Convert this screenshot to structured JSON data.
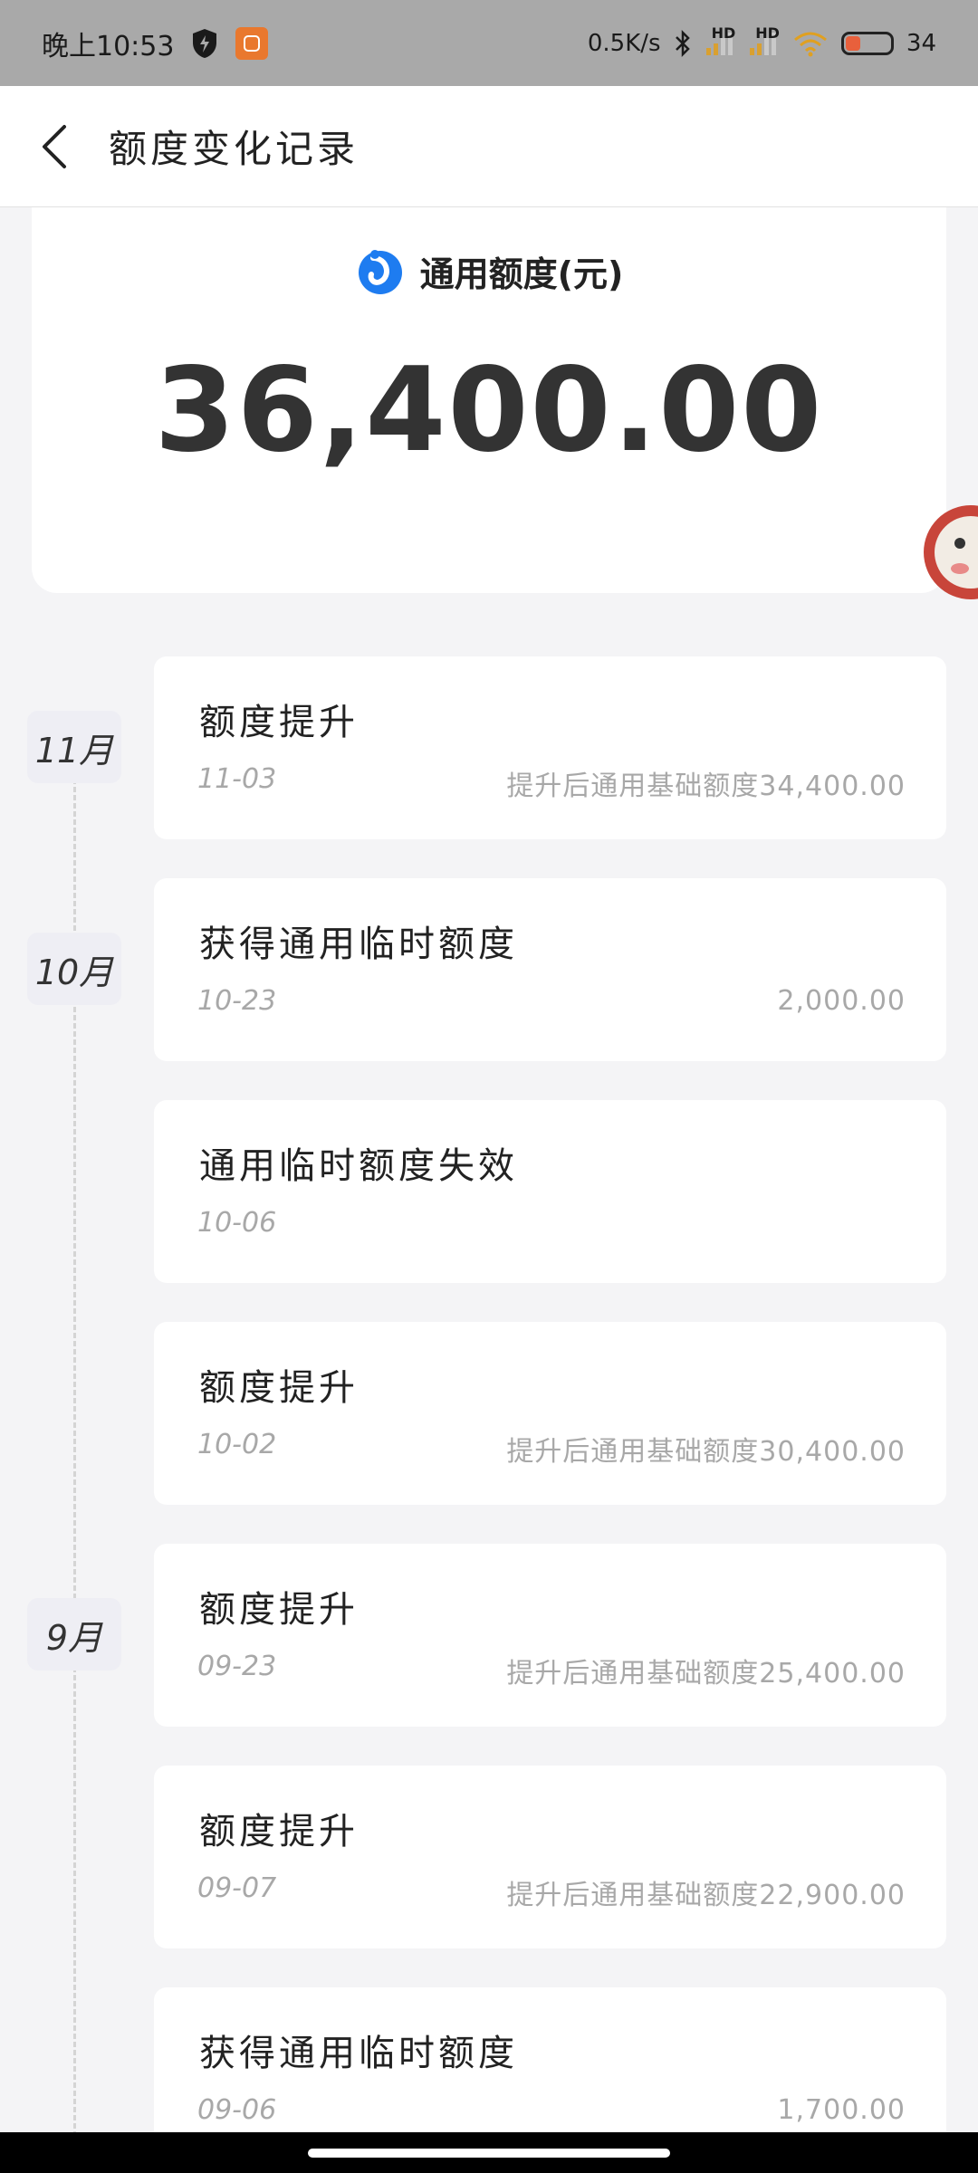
{
  "status_bar": {
    "time": "晚上10:53",
    "network_speed": "0.5K/s",
    "hd1": "HD",
    "hd2": "HD",
    "battery": "34",
    "icons": [
      "shield-icon",
      "mi-app-icon",
      "bluetooth-icon",
      "signal-icon",
      "wifi-icon",
      "battery-icon"
    ]
  },
  "nav": {
    "title": "额度变化记录",
    "back_icon": "chevron-left-icon"
  },
  "summary": {
    "label": "通用额度(元)",
    "amount": "36,400.00",
    "icon": "brand-logo-icon"
  },
  "months": [
    {
      "label": "11月"
    },
    {
      "label": "10月"
    },
    {
      "label": "9月"
    }
  ],
  "records": [
    {
      "title": "额度提升",
      "date": "11-03",
      "detail": "提升后通用基础额度34,400.00"
    },
    {
      "title": "获得通用临时额度",
      "date": "10-23",
      "detail": "2,000.00"
    },
    {
      "title": "通用临时额度失效",
      "date": "10-06",
      "detail": ""
    },
    {
      "title": "额度提升",
      "date": "10-02",
      "detail": "提升后通用基础额度30,400.00"
    },
    {
      "title": "额度提升",
      "date": "09-23",
      "detail": "提升后通用基础额度25,400.00"
    },
    {
      "title": "额度提升",
      "date": "09-07",
      "detail": "提升后通用基础额度22,900.00"
    },
    {
      "title": "获得通用临时额度",
      "date": "09-06",
      "detail": "1,700.00"
    }
  ],
  "colors": {
    "background": "#f4f4f6",
    "status_bar": "#a9a9a9",
    "brand_blue": "#1e7cf0",
    "muted_text": "#a8a8a8"
  }
}
